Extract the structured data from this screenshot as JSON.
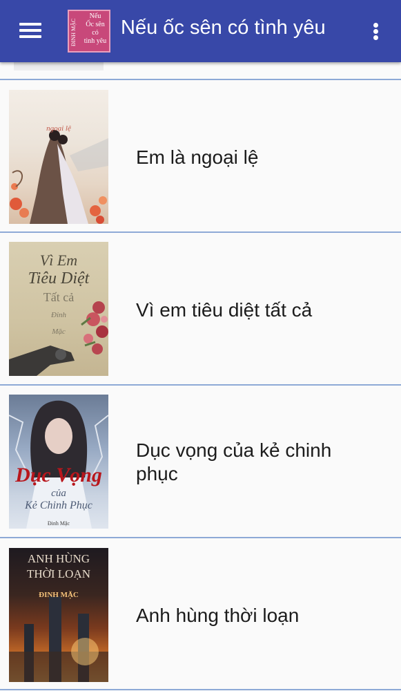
{
  "app_bar": {
    "title": "Nếu ốc sên có tình yêu",
    "menu_icon": "hamburger-menu-icon",
    "overflow_icon": "more-vert-icon",
    "logo": {
      "author_text": "ĐINH MẶC",
      "title_text": "Nếu\nỐc sên\ncó\ntình yêu",
      "color": "#c8487a"
    },
    "color": "#3848a8"
  },
  "items": [
    {
      "title": "Em là ngoại lệ",
      "cover_text": [
        "ngoại lệ"
      ]
    },
    {
      "title": "Vì em tiêu diệt tất cả",
      "cover_text": [
        "Vì Em",
        "Tiêu Diệt",
        "Tất cả",
        "Đinh",
        "Mặc"
      ]
    },
    {
      "title": "Dục vọng của kẻ chinh phục",
      "cover_text": [
        "Dục Vọng",
        "của",
        "Kẻ Chinh Phục",
        "Đinh Mặc"
      ]
    },
    {
      "title": "Anh hùng thời loạn",
      "cover_text": [
        "ANH HÙNG",
        "THỜI LOẠN",
        "ĐINH MẶC"
      ]
    }
  ],
  "colors": {
    "divider": "#8da9d6",
    "background": "#fafafa",
    "text": "#1c1c1c"
  }
}
